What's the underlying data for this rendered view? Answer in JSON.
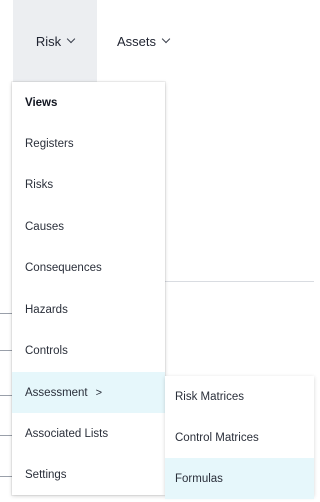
{
  "nav": {
    "items": [
      {
        "label": "Risk",
        "active": true
      },
      {
        "label": "Assets",
        "active": false
      }
    ]
  },
  "menu": {
    "header": "Views",
    "items": [
      {
        "label": "Registers"
      },
      {
        "label": "Risks"
      },
      {
        "label": "Causes"
      },
      {
        "label": "Consequences"
      },
      {
        "label": "Hazards"
      },
      {
        "label": "Controls"
      },
      {
        "label": "Assessment",
        "has_submenu": true,
        "highlighted": true
      },
      {
        "label": "Associated Lists"
      },
      {
        "label": "Settings"
      }
    ],
    "submenu_arrow": ">"
  },
  "submenu": {
    "items": [
      {
        "label": "Risk Matrices"
      },
      {
        "label": "Control Matrices"
      },
      {
        "label": "Formulas",
        "highlighted": true
      }
    ]
  },
  "colors": {
    "active_nav_bg": "#eceef1",
    "highlight_bg": "#e6f7fb",
    "text": "#1f2330"
  }
}
